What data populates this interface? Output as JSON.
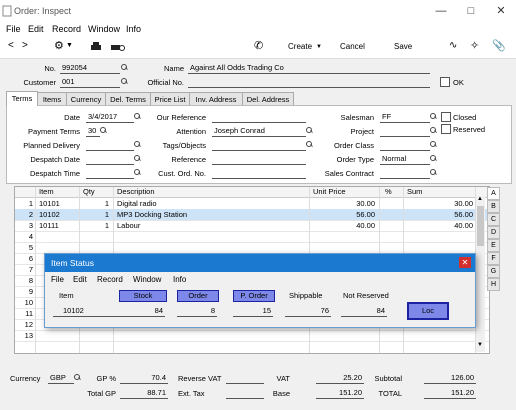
{
  "window": {
    "title": "Order: Inspect",
    "controls": [
      "minimize",
      "maximize",
      "close"
    ]
  },
  "menu": [
    "File",
    "Edit",
    "Record",
    "Window",
    "Info"
  ],
  "toolbar": {
    "create": "Create",
    "cancel": "Cancel",
    "save": "Save"
  },
  "header": {
    "no_label": "No.",
    "no_value": "992054",
    "name_label": "Name",
    "name_value": "Against All Odds Trading Co",
    "customer_label": "Customer",
    "customer_value": "001",
    "official_label": "Official No.",
    "official_value": "",
    "ok_label": "OK"
  },
  "tabs": [
    "Terms",
    "Items",
    "Currency",
    "Del. Terms",
    "Price List",
    "Inv. Address",
    "Del. Address"
  ],
  "terms": {
    "date_label": "Date",
    "date_value": "3/4/2017",
    "our_ref_label": "Our Reference",
    "our_ref_value": "",
    "salesman_label": "Salesman",
    "salesman_value": "FF",
    "closed_label": "Closed",
    "reserved_label": "Reserved",
    "payment_terms_label": "Payment Terms",
    "payment_terms_value": "30",
    "attention_label": "Attention",
    "attention_value": "Joseph Conrad",
    "project_label": "Project",
    "project_value": "",
    "planned_delivery_label": "Planned Delivery",
    "planned_delivery_value": "",
    "tags_label": "Tags/Objects",
    "tags_value": "",
    "order_class_label": "Order Class",
    "order_class_value": "",
    "despatch_date_label": "Despatch Date",
    "despatch_date_value": "",
    "reference_label": "Reference",
    "reference_value": "",
    "order_type_label": "Order Type",
    "order_type_value": "Normal",
    "despatch_time_label": "Despatch Time",
    "despatch_time_value": "",
    "cust_ord_label": "Cust. Ord. No.",
    "cust_ord_value": "",
    "sales_contract_label": "Sales Contract",
    "sales_contract_value": ""
  },
  "grid": {
    "headers": [
      "Item",
      "Qty",
      "Description",
      "Unit Price",
      "%",
      "Sum"
    ],
    "rows": [
      {
        "n": "1",
        "item": "10101",
        "qty": "1",
        "desc": "Digital radio",
        "price": "30.00",
        "pct": "",
        "sum": "30.00"
      },
      {
        "n": "2",
        "item": "10102",
        "qty": "1",
        "desc": "MP3 Docking Station",
        "price": "56.00",
        "pct": "",
        "sum": "56.00"
      },
      {
        "n": "3",
        "item": "10111",
        "qty": "1",
        "desc": "Labour",
        "price": "40.00",
        "pct": "",
        "sum": "40.00"
      },
      {
        "n": "4"
      },
      {
        "n": "5"
      },
      {
        "n": "6"
      },
      {
        "n": "7"
      },
      {
        "n": "8"
      },
      {
        "n": "9"
      },
      {
        "n": "10"
      },
      {
        "n": "11"
      },
      {
        "n": "12"
      },
      {
        "n": "13"
      }
    ],
    "side_tabs": [
      "A",
      "B",
      "C",
      "D",
      "E",
      "F",
      "G",
      "H"
    ]
  },
  "item_status": {
    "title": "Item Status",
    "menu": [
      "File",
      "Edit",
      "Record",
      "Window",
      "Info"
    ],
    "item_label": "Item",
    "item_value": "10102",
    "stock_label": "Stock",
    "stock_value": "84",
    "order_label": "Order",
    "order_value": "8",
    "porder_label": "P. Order",
    "porder_value": "15",
    "shippable_label": "Shippable",
    "shippable_value": "76",
    "not_reserved_label": "Not Reserved",
    "not_reserved_value": "84",
    "loc_label": "Loc"
  },
  "footer": {
    "currency_label": "Currency",
    "currency_value": "GBP",
    "gp_pct_label": "GP %",
    "gp_pct_value": "70.4",
    "reverse_vat_label": "Reverse VAT",
    "reverse_vat_value": "",
    "vat_label": "VAT",
    "vat_value": "25.20",
    "subtotal_label": "Subtotal",
    "subtotal_value": "126.00",
    "total_gp_label": "Total GP",
    "total_gp_value": "88.71",
    "ext_tax_label": "Ext. Tax",
    "ext_tax_value": "",
    "base_label": "Base",
    "base_value": "151.20",
    "total_label": "TOTAL",
    "total_value": "151.20"
  }
}
